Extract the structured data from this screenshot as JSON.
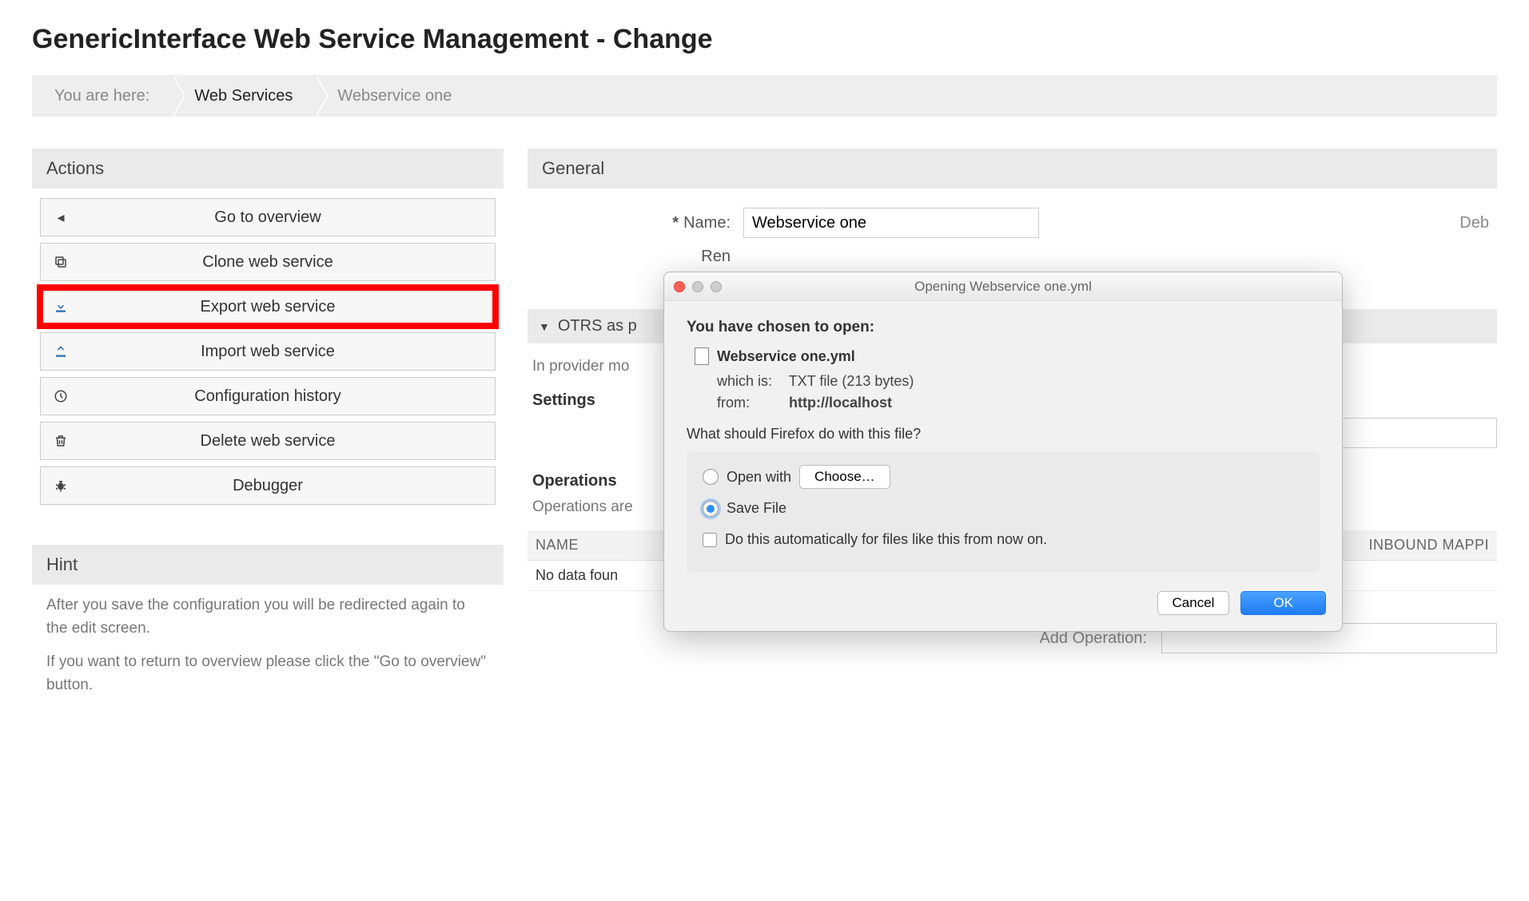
{
  "page_title": "GenericInterface Web Service Management - Change",
  "breadcrumb": {
    "label": "You are here:",
    "items": [
      "Web Services",
      "Webservice one"
    ],
    "active_index": 0
  },
  "actions": {
    "header": "Actions",
    "buttons": [
      {
        "label": "Go to overview",
        "icon": "◂"
      },
      {
        "label": "Clone web service",
        "icon_name": "copy-icon"
      },
      {
        "label": "Export web service",
        "icon_name": "download-icon",
        "highlighted": true
      },
      {
        "label": "Import web service",
        "icon_name": "upload-icon"
      },
      {
        "label": "Configuration history",
        "icon_name": "clock-icon"
      },
      {
        "label": "Delete web service",
        "icon_name": "trash-icon"
      },
      {
        "label": "Debugger",
        "icon_name": "bug-icon"
      }
    ]
  },
  "hint": {
    "header": "Hint",
    "p1": "After you save the configuration you will be redirected again to the edit screen.",
    "p2": "If you want to return to overview please click the \"Go to overview\" button."
  },
  "general": {
    "header": "General",
    "name_label": "Name:",
    "name_value": "Webservice one",
    "remote_label_partial": "Ren",
    "right_label_partial": "Deb"
  },
  "provider_section": {
    "title_partial": "OTRS as p",
    "sub_text_partial": "In provider mo",
    "settings_label": "Settings",
    "operations_label": "Operations",
    "operations_sub_partial": "Operations are",
    "table": {
      "col_name": "NAME",
      "col_inbound_partial": "INBOUND MAPPI",
      "no_data_partial": "No data foun"
    },
    "add_label": "Add Operation:"
  },
  "dialog": {
    "title": "Opening Webservice one.yml",
    "chosen": "You have chosen to open:",
    "filename": "Webservice one.yml",
    "which_is_label": "which is:",
    "which_is_value": "TXT file (213 bytes)",
    "from_label": "from:",
    "from_value": "http://localhost",
    "question": "What should Firefox do with this file?",
    "open_with": "Open with",
    "choose": "Choose…",
    "save_file": "Save File",
    "auto": "Do this automatically for files like this from now on.",
    "cancel": "Cancel",
    "ok": "OK"
  }
}
